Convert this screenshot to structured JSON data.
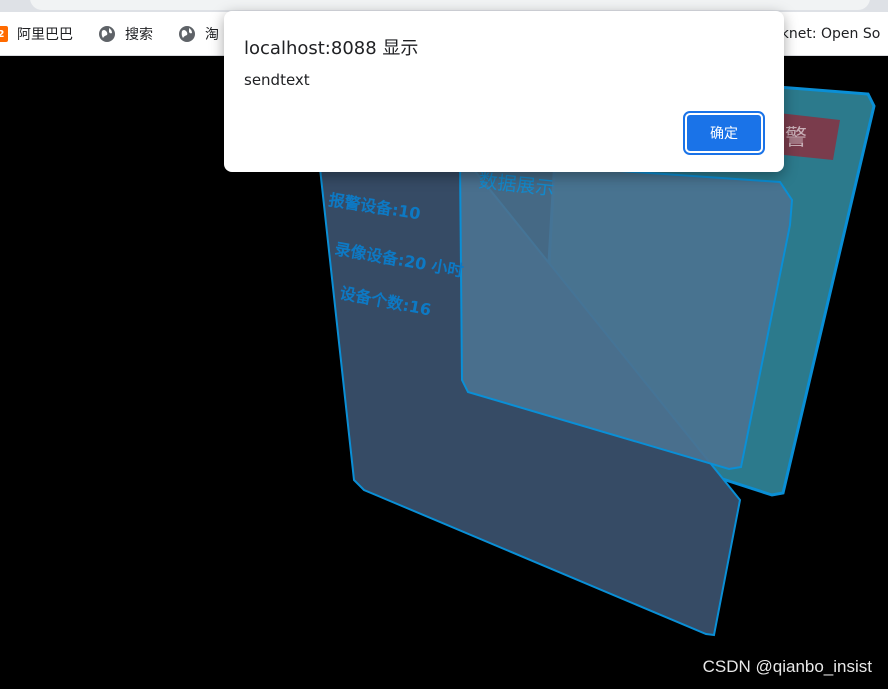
{
  "bookmarks": [
    {
      "label": "阿里巴巴",
      "icon": "alibaba-icon"
    },
    {
      "label": "搜索",
      "icon": "globe-icon"
    },
    {
      "label": "淘",
      "icon": "globe-icon"
    },
    {
      "label": "rknet: Open So",
      "icon": "none"
    }
  ],
  "dialog": {
    "title": "localhost:8088 显示",
    "message": "sendtext",
    "ok_label": "确定"
  },
  "panels": {
    "back_alarm_label": "警",
    "middle_title": "数据展示",
    "front_lines": [
      "报警设备:10",
      "录像设备:20 小时",
      "设备个数:16"
    ]
  },
  "watermark": "CSDN @qianbo_insist",
  "colors": {
    "dialog_button": "#1a73e8",
    "panel_border": "#0a8fd6",
    "panel_text": "#0d79c4",
    "alarm_box": "#7a3c4c"
  }
}
